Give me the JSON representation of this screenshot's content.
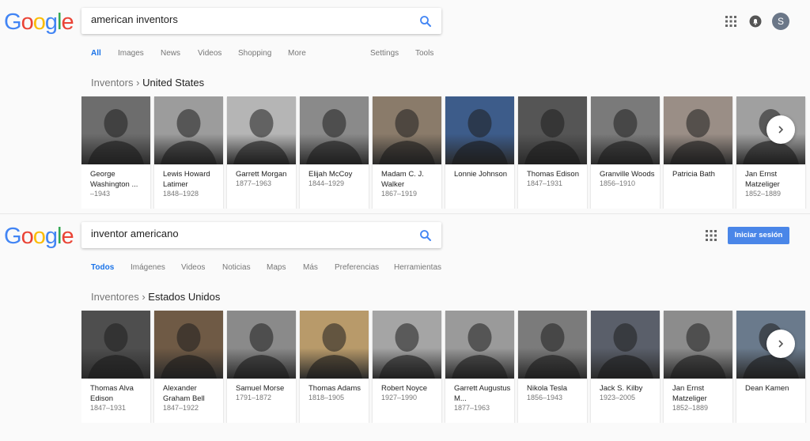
{
  "screen1": {
    "logo": "Google",
    "query": "american inventors",
    "tabs": [
      {
        "label": "All",
        "active": true
      },
      {
        "label": "Images"
      },
      {
        "label": "News"
      },
      {
        "label": "Videos"
      },
      {
        "label": "Shopping"
      },
      {
        "label": "More"
      },
      {
        "label": "Settings"
      },
      {
        "label": "Tools"
      }
    ],
    "breadcrumb_parent": "Inventors",
    "breadcrumb_sep": "›",
    "breadcrumb_current": "United States",
    "avatar_letter": "S",
    "cards": [
      {
        "name": "George Washington ...",
        "years": "–1943",
        "bg": "#6d6d6d"
      },
      {
        "name": "Lewis Howard Latimer",
        "years": "1848–1928",
        "bg": "#9c9c9c"
      },
      {
        "name": "Garrett Morgan",
        "years": "1877–1963",
        "bg": "#b5b5b5"
      },
      {
        "name": "Elijah McCoy",
        "years": "1844–1929",
        "bg": "#8a8a8a"
      },
      {
        "name": "Madam C. J. Walker",
        "years": "1867–1919",
        "bg": "#8a7b6a"
      },
      {
        "name": "Lonnie Johnson",
        "years": "",
        "bg": "#3d5c8a"
      },
      {
        "name": "Thomas Edison",
        "years": "1847–1931",
        "bg": "#555555"
      },
      {
        "name": "Granville Woods",
        "years": "1856–1910",
        "bg": "#7a7a7a"
      },
      {
        "name": "Patricia Bath",
        "years": "",
        "bg": "#9a8e86"
      },
      {
        "name": "Jan Ernst Matzeliger",
        "years": "1852–1889",
        "bg": "#a0a0a0"
      }
    ]
  },
  "screen2": {
    "logo": "Google",
    "query": "inventor americano",
    "tabs": [
      {
        "label": "Todos",
        "active": true
      },
      {
        "label": "Imágenes"
      },
      {
        "label": "Videos"
      },
      {
        "label": "Noticias"
      },
      {
        "label": "Maps"
      },
      {
        "label": "Más"
      },
      {
        "label": "Preferencias"
      },
      {
        "label": "Herramientas"
      }
    ],
    "breadcrumb_parent": "Inventores",
    "breadcrumb_sep": "›",
    "breadcrumb_current": "Estados Unidos",
    "signin_label": "Iniciar sesión",
    "cards": [
      {
        "name": "Thomas Alva Edison",
        "years": "1847–1931",
        "bg": "#4e4e4e"
      },
      {
        "name": "Alexander Graham Bell",
        "years": "1847–1922",
        "bg": "#6f5a45"
      },
      {
        "name": "Samuel Morse",
        "years": "1791–1872",
        "bg": "#8a8a8a"
      },
      {
        "name": "Thomas Adams",
        "years": "1818–1905",
        "bg": "#b89a6a"
      },
      {
        "name": "Robert Noyce",
        "years": "1927–1990",
        "bg": "#a5a5a5"
      },
      {
        "name": "Garrett Augustus M...",
        "years": "1877–1963",
        "bg": "#9a9a9a"
      },
      {
        "name": "Nikola Tesla",
        "years": "1856–1943",
        "bg": "#7b7b7b"
      },
      {
        "name": "Jack S. Kilby",
        "years": "1923–2005",
        "bg": "#5a5f6a"
      },
      {
        "name": "Jan Ernst Matzeliger",
        "years": "1852–1889",
        "bg": "#8c8c8c"
      },
      {
        "name": "Dean Kamen",
        "years": "",
        "bg": "#6a7a8c"
      }
    ]
  },
  "colors": {
    "blue": "#4285F4",
    "red": "#EA4335",
    "yellow": "#FBBC05",
    "green": "#34A853",
    "active_tab": "#1a73e8"
  }
}
